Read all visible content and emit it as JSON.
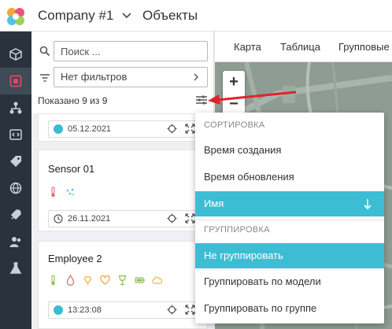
{
  "colors": {
    "accent": "#3dbdd4",
    "nav_bg": "#2a333c",
    "status_online": "#3abcd1",
    "annotation_arrow": "#e0242b"
  },
  "header": {
    "company": "Company #1",
    "title": "Объекты"
  },
  "nav": [
    "cube-icon",
    "objects-icon",
    "hierarchy-icon",
    "code-icon",
    "tag-icon",
    "globe-icon",
    "rocket-icon",
    "users-icon",
    "flask-icon"
  ],
  "search": {
    "placeholder": "Поиск ..."
  },
  "filter": {
    "value": "Нет фильтров"
  },
  "list": {
    "shown": "Показано 9 из 9",
    "cards": [
      {
        "name": "",
        "date": "05.12.2021",
        "status": "online"
      },
      {
        "name": "Sensor 01",
        "date": "26.11.2021",
        "status": "clock",
        "icons": [
          "thermometer-icon",
          "humidity-icon"
        ]
      },
      {
        "name": "Employee 2",
        "date": "13:23:08",
        "status": "online",
        "icons": [
          "thermometer-icon",
          "drop-icon",
          "bulb-icon",
          "heart-icon",
          "glass-icon",
          "battery-icon",
          "cloud-icon"
        ]
      }
    ]
  },
  "map": {
    "tabs": [
      "Карта",
      "Таблица",
      "Групповые"
    ]
  },
  "sort_menu": {
    "sort_header": "СОРТИРОВКА",
    "sort_items": [
      "Время создания",
      "Время обновления",
      "Имя"
    ],
    "sort_selected": "Имя",
    "sort_direction": "descending",
    "group_header": "ГРУППИРОВКА",
    "group_items": [
      "Не группировать",
      "Группировать по модели",
      "Группировать по группе"
    ],
    "group_selected": "Не группировать"
  }
}
